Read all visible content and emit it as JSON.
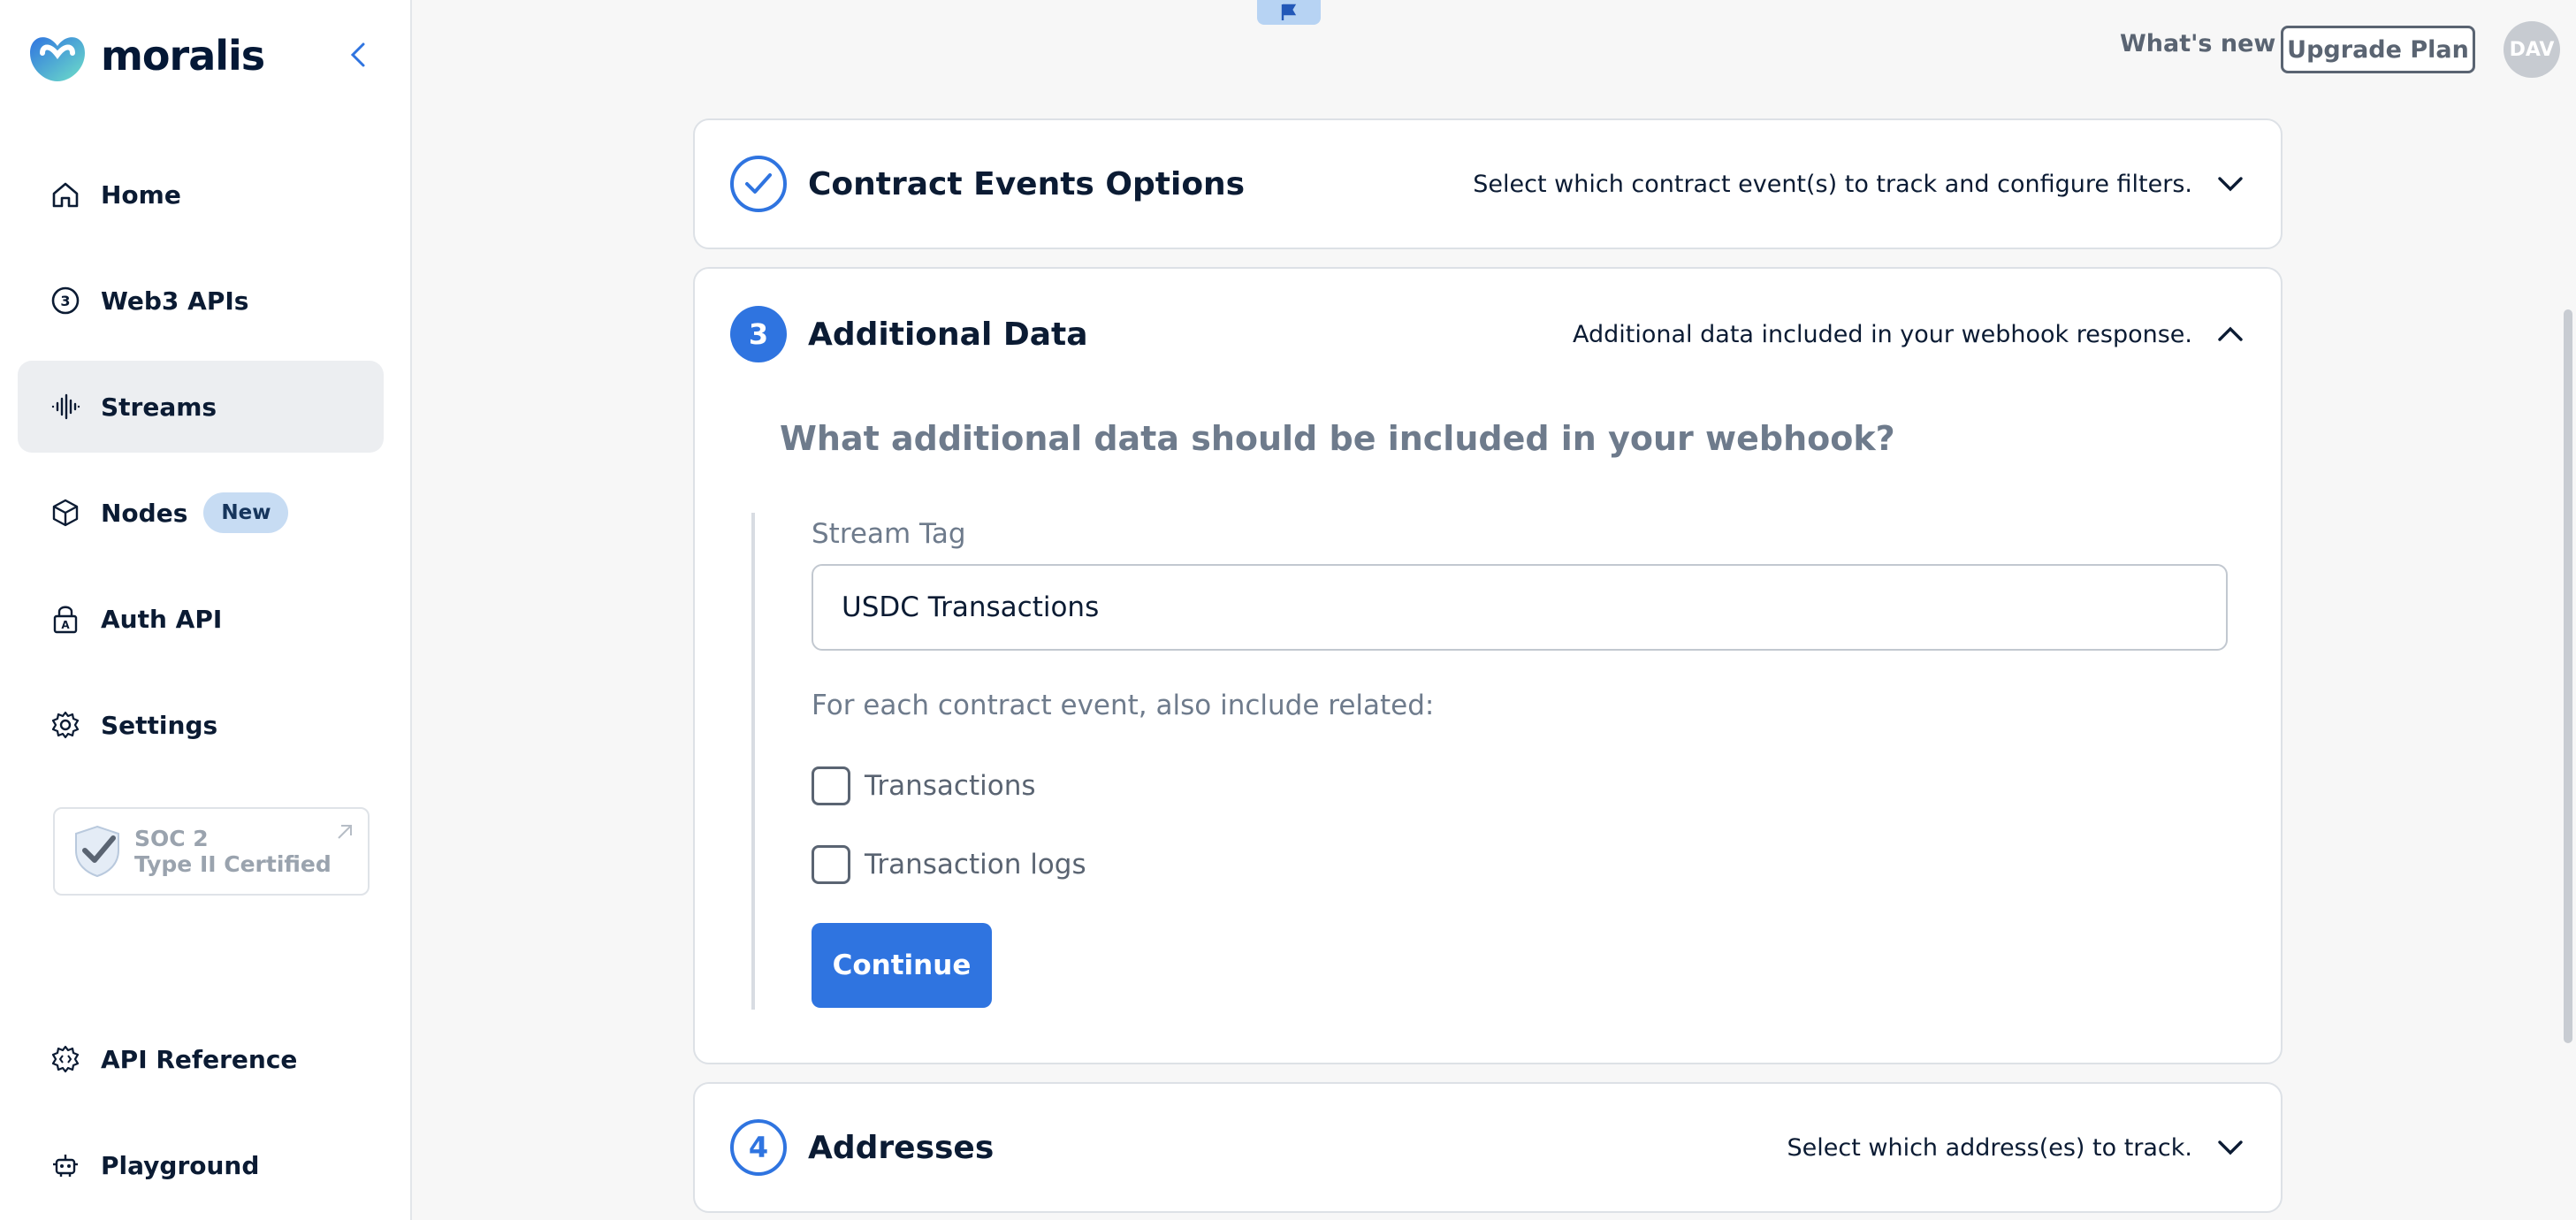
{
  "brand": {
    "name": "moralis",
    "color": "#2f74e0"
  },
  "sidebar": {
    "items": [
      {
        "label": "Home",
        "icon": "home-icon"
      },
      {
        "label": "Web3 APIs",
        "icon": "web3-coin-icon"
      },
      {
        "label": "Streams",
        "icon": "streams-waveform-icon",
        "active": true
      },
      {
        "label": "Nodes",
        "icon": "cube-icon",
        "badge": "New"
      },
      {
        "label": "Auth API",
        "icon": "lock-icon"
      },
      {
        "label": "Settings",
        "icon": "gear-icon"
      }
    ],
    "soc": {
      "line1": "SOC 2",
      "line2": "Type II Certified"
    },
    "bottom": [
      {
        "label": "API Reference",
        "icon": "api-gear-icon"
      },
      {
        "label": "Playground",
        "icon": "robot-icon"
      }
    ]
  },
  "topbar": {
    "whats_new": "What's new",
    "upgrade": "Upgrade Plan",
    "avatar": "DAV"
  },
  "cards": {
    "contract_events": {
      "title": "Contract Events Options",
      "desc": "Select which contract event(s) to track and configure filters."
    },
    "additional_data": {
      "step": "3",
      "title": "Additional Data",
      "desc": "Additional data included in your webhook response.",
      "question": "What additional data should be included in your webhook?",
      "stream_tag_label": "Stream Tag",
      "stream_tag_value": "USDC Transactions",
      "include_label": "For each contract event, also include related:",
      "options": [
        "Transactions",
        "Transaction logs"
      ],
      "continue": "Continue"
    },
    "addresses": {
      "step": "4",
      "title": "Addresses",
      "desc": "Select which address(es) to track."
    }
  }
}
